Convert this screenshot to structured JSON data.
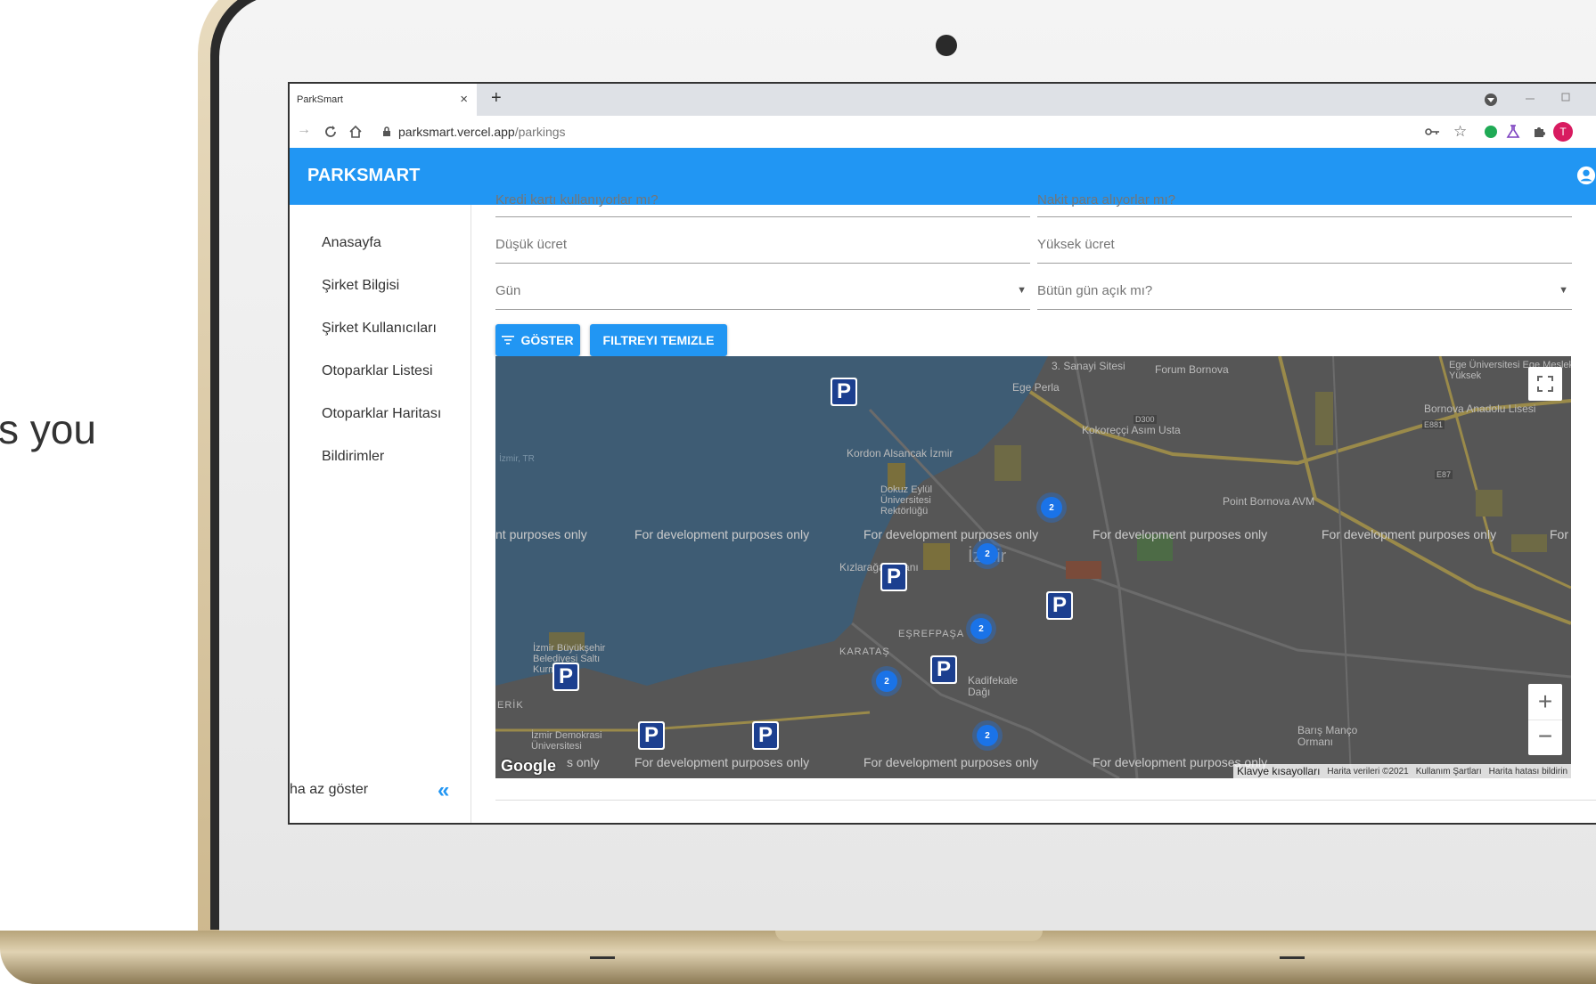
{
  "background_text": "s you",
  "browser": {
    "tab_title": "ParkSmart",
    "tab_close": "×",
    "new_tab": "+",
    "url_host": "parksmart.vercel.app",
    "url_path": "/parkings",
    "profile_initial": "T"
  },
  "appbar": {
    "title": "PARKSMART"
  },
  "sidebar": {
    "items": [
      {
        "label": "Anasayfa"
      },
      {
        "label": "Şirket Bilgisi"
      },
      {
        "label": "Şirket Kullanıcıları"
      },
      {
        "label": "Otoparklar Listesi"
      },
      {
        "label": "Otoparklar Haritası"
      },
      {
        "label": "Bildirimler"
      }
    ],
    "footer_label": "ha az göster",
    "collapse_icon": "«"
  },
  "filters": {
    "credit_card_label": "Kredi kartı kullanıyorlar mı?",
    "cash_label": "Nakit para alıyorlar mı?",
    "low_price_placeholder": "Düşük ücret",
    "high_price_placeholder": "Yüksek ücret",
    "day_label": "Gün",
    "all_day_label": "Bütün gün açık mı?",
    "show_button": "GÖSTER",
    "clear_button": "FILTREYI TEMIZLE"
  },
  "map": {
    "watermark": "For development purposes only",
    "watermark_left_partial": "nt purposes only",
    "watermark_right_partial": "For",
    "watermark_bottom_partial": "s only",
    "cluster_count": "2",
    "parking_marker": "P",
    "zoom_in": "+",
    "zoom_out": "−",
    "google_logo": "Google",
    "footer_shortcuts": "Klavye kısayolları",
    "footer_data": "Harita verileri ©2021",
    "footer_terms": "Kullanım Şartları",
    "footer_report": "Harita hatası bildirin",
    "places": [
      "3. Sanayi Sitesi",
      "Forum Bornova",
      "Ege Üniversitesi Ege Meslek Yüksek",
      "Ege Perla",
      "Bornova Anadolu Lisesi",
      "Kokoreççi Asım Usta",
      "Kordon Alsancak İzmir",
      "Dokuz Eylül Üniversitesi Rektörlüğü",
      "Point Bornova AVM",
      "İzmir",
      "Kızlarağası Hanı",
      "EŞREFPAŞA",
      "KARATAŞ",
      "İzmir Büyükşehir Belediyesi Saltı Kurmanı",
      "Kadifekale Dağı",
      "Barış Manço Ormanı",
      "İzmir Demokrasi Üniversitesi",
      "ERİK",
      "İzmir, TR",
      "D300",
      "E881",
      "E87"
    ]
  },
  "colors": {
    "primary": "#2196f3",
    "map_water": "#3e5c74",
    "map_land": "#555555"
  }
}
